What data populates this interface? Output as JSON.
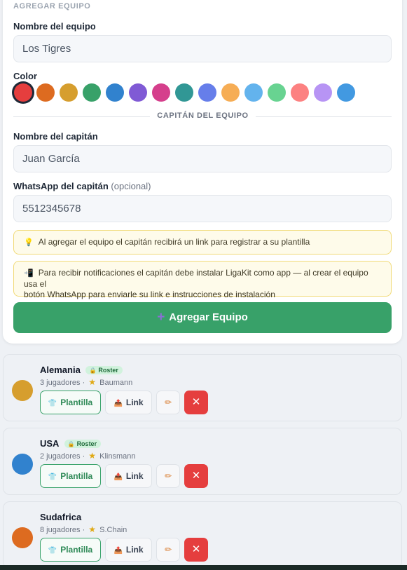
{
  "form": {
    "section_title": "AGREGAR EQUIPO",
    "team_name_label": "Nombre del equipo",
    "team_name_value": "Los Tigres",
    "color_label": "Color",
    "colors": [
      "#e53e3e",
      "#dd6b20",
      "#d69e2e",
      "#38a169",
      "#3182ce",
      "#805ad5",
      "#d53f8c",
      "#319795",
      "#667eea",
      "#f6ad55",
      "#63b3ed",
      "#68d391",
      "#fc8181",
      "#b794f4",
      "#4299e1"
    ],
    "selected_color_index": 0,
    "captain_section": "CAPITÁN DEL EQUIPO",
    "captain_name_label": "Nombre del capitán",
    "captain_name_value": "Juan García",
    "whatsapp_label": "WhatsApp del capitán",
    "whatsapp_optional": "(opcional)",
    "whatsapp_value": "5512345678",
    "notice_1": "Al agregar el equipo el capitán recibirá un link para registrar a su plantilla",
    "notice_2_line1": "Para recibir notificaciones el capitán debe instalar LigaKit como app — al crear el equipo usa el",
    "notice_2_line2": "botón WhatsApp para enviarle su link e instrucciones de instalación",
    "add_button": "Agregar Equipo"
  },
  "teams": [
    {
      "name": "Alemania",
      "badge": "Roster",
      "players": "3 jugadores",
      "captain": "Baumann",
      "color": "#d69e2e"
    },
    {
      "name": "USA",
      "badge": "Roster",
      "players": "2 jugadores",
      "captain": "Klinsmann",
      "color": "#3182ce"
    },
    {
      "name": "Sudafrica",
      "badge": "",
      "players": "8 jugadores",
      "captain": "S.Chain",
      "color": "#dd6b20"
    }
  ],
  "actions": {
    "plantilla": "Plantilla",
    "link": "Link",
    "delete": "✕",
    "separator": "·"
  },
  "icons": {
    "lightbulb": "lightbulb-icon",
    "phone": "phone-icon",
    "plus": "plus-icon",
    "lock": "lock-icon",
    "star": "star-icon",
    "shirt": "shirt-icon",
    "link": "link-icon",
    "pencil": "pencil-icon",
    "close": "close-icon"
  }
}
